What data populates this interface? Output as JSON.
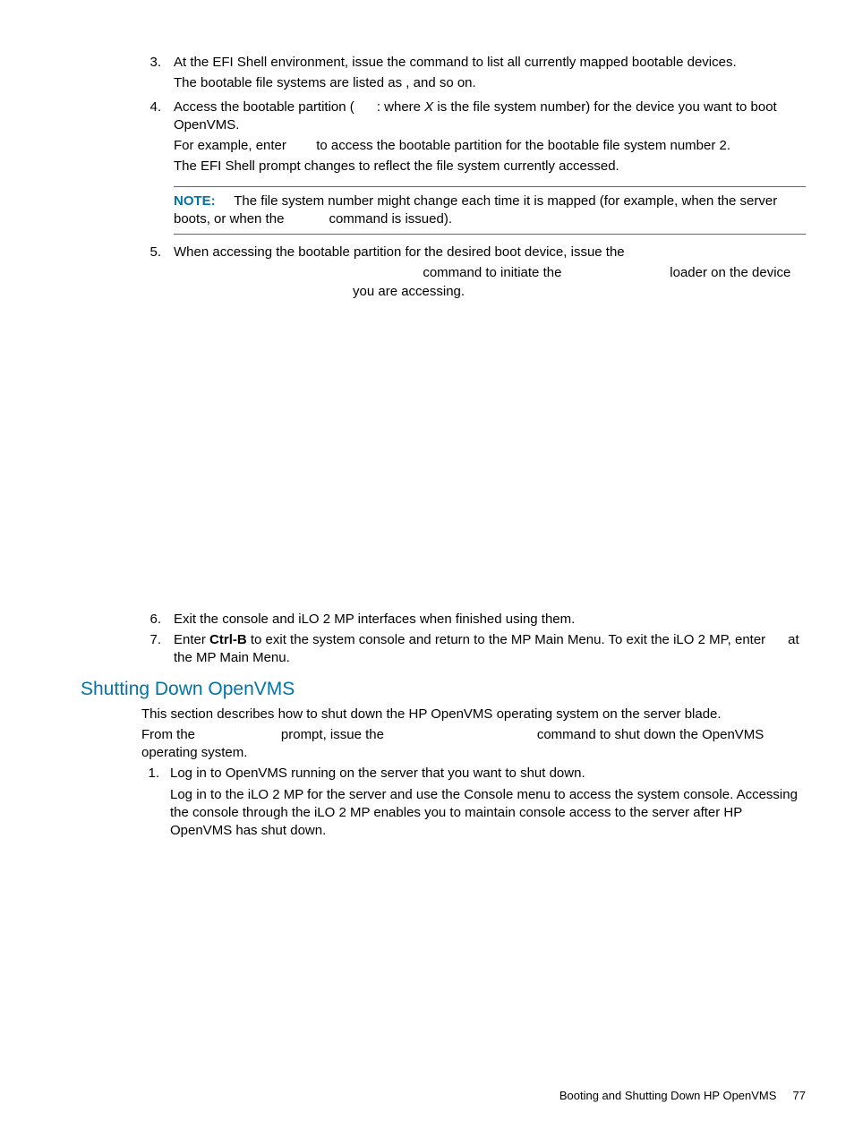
{
  "steps": {
    "s3": {
      "num": "3.",
      "line1a": "At the EFI Shell environment, issue the ",
      "line1b": " command to list all currently mapped bootable devices.",
      "line2a": "The bootable file systems are listed as ",
      "line2b": ", and so on."
    },
    "s4": {
      "num": "4.",
      "line1a": "Access the bootable partition (",
      "line1b": ": where ",
      "line1c": "X",
      "line1d": " is the file system number) for the device you want to boot OpenVMS.",
      "line2a": "For example, enter ",
      "line2b": " to access the bootable partition for the bootable file system number 2.",
      "line3": "The EFI Shell prompt changes to reflect the file system currently accessed."
    },
    "note": {
      "label": "NOTE:",
      "text1": "The file system number might change each time it is mapped (for example, when the server boots, or when the ",
      "text2": " command is issued)."
    },
    "s5": {
      "num": "5.",
      "line1": "When accessing the bootable partition for the desired boot device, issue the",
      "line2a": " command to initiate the ",
      "line2b": " loader on the device you are accessing."
    },
    "s6": {
      "num": "6.",
      "line1": "Exit the console and iLO 2 MP interfaces when finished using them."
    },
    "s7": {
      "num": "7.",
      "line1a": "Enter ",
      "line1b": "Ctrl-B",
      "line1c": " to exit the system console and return to the MP Main Menu. To exit the iLO 2 MP, enter ",
      "line1d": " at the MP Main Menu."
    }
  },
  "section": {
    "heading": "Shutting Down OpenVMS",
    "p1": "This section describes how to shut down the HP OpenVMS operating system on the server blade.",
    "p2a": "From the ",
    "p2b": " prompt, issue the ",
    "p2c": " command to shut down the OpenVMS operating system.",
    "ol1": {
      "num": "1.",
      "line1": "Log in to OpenVMS running on the server that you want to shut down.",
      "line2": "Log in to the iLO 2 MP for the server and use the Console menu to access the system console. Accessing the console through the iLO 2 MP enables you to maintain console access to the server after HP OpenVMS has shut down."
    }
  },
  "footer": {
    "text": "Booting and Shutting Down HP OpenVMS",
    "page": "77"
  }
}
